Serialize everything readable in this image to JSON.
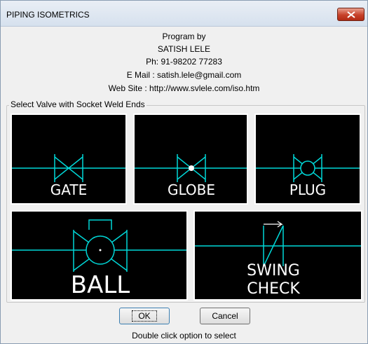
{
  "window": {
    "title": "PIPING ISOMETRICS"
  },
  "info": [
    "Program by",
    "SATISH LELE",
    "Ph: 91-98202 77283",
    "E Mail : satish.lele@gmail.com",
    "Web Site : http://www.svlele.com/iso.htm"
  ],
  "group_label": "Select Valve with Socket Weld Ends",
  "valves": {
    "gate": "GATE",
    "globe": "GLOBE",
    "plug": "PLUG",
    "ball": "BALL",
    "swing_line1": "SWING",
    "swing_line2": "CHECK"
  },
  "buttons": {
    "ok": "OK",
    "cancel": "Cancel"
  },
  "hint": "Double click option to select",
  "colors": {
    "tile_bg": "#000000",
    "line": "#00d8d8",
    "label": "#ffffff",
    "close_button": "#c7412a"
  }
}
